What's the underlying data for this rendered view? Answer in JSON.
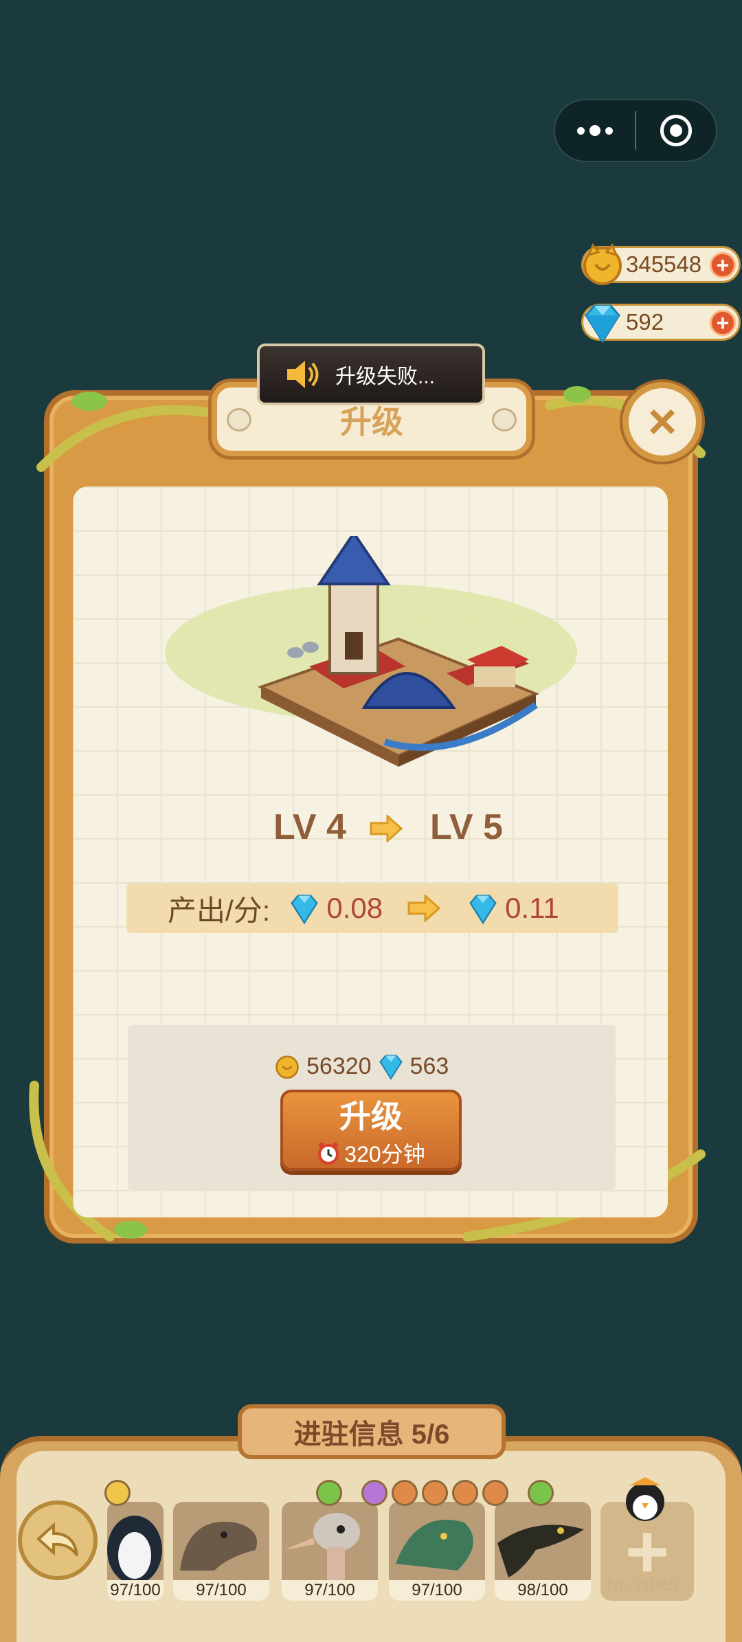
{
  "currencies": {
    "coins": "345548",
    "gems": "592"
  },
  "dialog": {
    "title": "升级",
    "toast": "升级失败...",
    "level_from": "LV 4",
    "level_to": "LV 5",
    "production_label": "产出/分:",
    "production_from": "0.08",
    "production_to": "0.11",
    "cost_coins": "56320",
    "cost_gems": "563",
    "upgrade_label": "升级",
    "upgrade_time": "320分钟"
  },
  "stationed": {
    "title": "进驻信息 5/6",
    "slots": [
      {
        "count": "97/100"
      },
      {
        "count": "97/100"
      },
      {
        "count": "97/100"
      },
      {
        "count": "97/100"
      },
      {
        "count": "98/100"
      }
    ],
    "add_slot_id": "No.11065"
  },
  "colors": {
    "background": "#1b3a3d",
    "wood": "#d89a44",
    "paper": "#f6f1e1",
    "value_red": "#b0453b"
  }
}
